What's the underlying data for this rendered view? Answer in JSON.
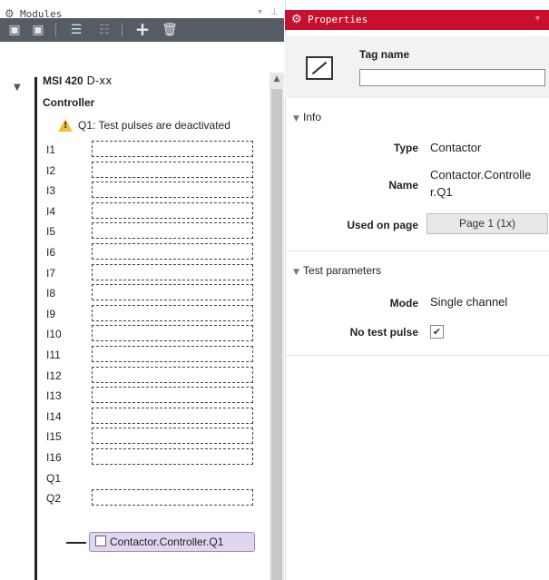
{
  "modules_panel": {
    "title": "Modules",
    "header_icons": [
      "gear-icon",
      "pin-icon"
    ],
    "toolbar": [
      "copy-icon",
      "paste-icon",
      "edit-icon",
      "disabled-icon",
      "add-icon",
      "delete-icon"
    ]
  },
  "module": {
    "name_bold": "MSI 420",
    "name_suffix": " D-xx",
    "subtitle": "Controller",
    "warning": "Q1: Test pulses are deactivated",
    "inputs": [
      "I1",
      "I2",
      "I3",
      "I4",
      "I5",
      "I6",
      "I7",
      "I8",
      "I9",
      "I10",
      "I11",
      "I12",
      "I13",
      "I14",
      "I15",
      "I16"
    ],
    "outputs": [
      "Q1",
      "Q2"
    ],
    "q1_element": "Contactor.Controller.Q1"
  },
  "properties_panel": {
    "title": "Properties",
    "tag_name_label": "Tag name",
    "tag_name_value": "",
    "info_section": "Info",
    "type_label": "Type",
    "type_value": "Contactor",
    "name_label": "Name",
    "name_value_line1": "Contactor.Controlle",
    "name_value_line2": "r.Q1",
    "used_on_page_label": "Used on page",
    "used_on_page_value": "Page 1 (1x)",
    "test_params_section": "Test parameters",
    "mode_label": "Mode",
    "mode_value": "Single channel",
    "no_test_pulse_label": "No test pulse",
    "no_test_pulse_checked": true
  },
  "colors": {
    "accent_red": "#c8102e",
    "toolbar_gray": "#555c63",
    "chip_purple": "#e0d6ef"
  }
}
